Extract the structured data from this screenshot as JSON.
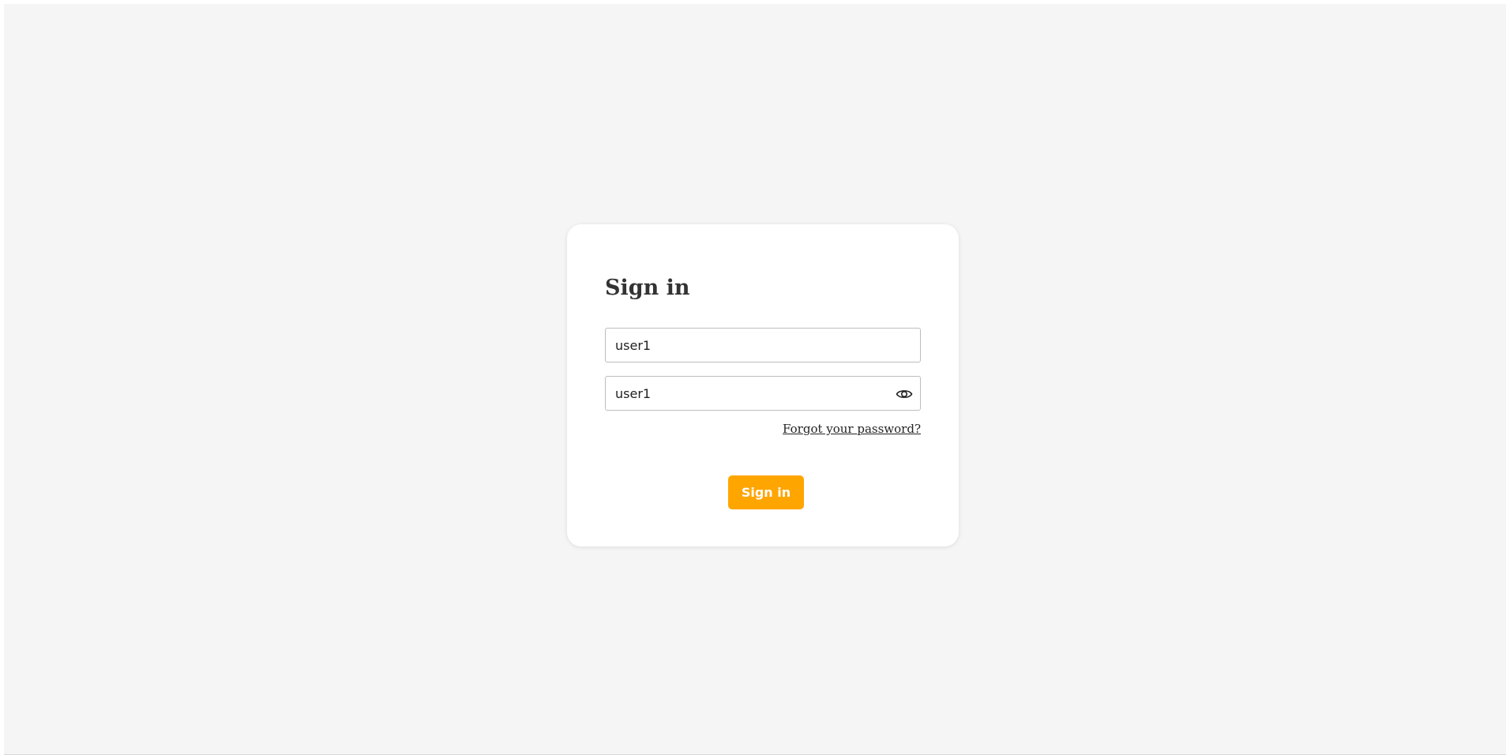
{
  "page": {
    "background_color": "#f5f5f5"
  },
  "signin_card": {
    "title": "Sign in",
    "username": {
      "value": "user1"
    },
    "password": {
      "value": "user1",
      "toggle_icon": "eye-icon"
    },
    "forgot_link": "Forgot your password?",
    "submit_label": "Sign in",
    "accent_color": "#ffa500"
  }
}
